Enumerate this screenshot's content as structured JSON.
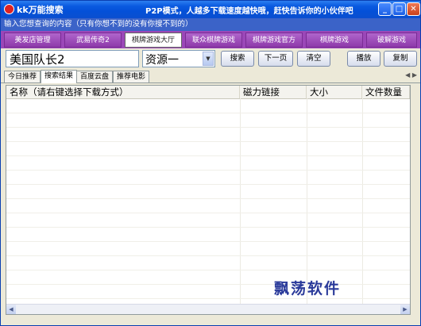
{
  "window": {
    "title": "kk万能搜索",
    "slogan": "P2P模式，人越多下载速度越快哦，赶快告诉你的小伙伴吧",
    "controls": {
      "minimize": "_",
      "maximize": "□",
      "close": "✕"
    }
  },
  "hint": "输入您想查询的内容（只有你想不到的没有你搜不到的）",
  "nav": [
    {
      "label": "美发店管理"
    },
    {
      "label": "武易传奇2"
    },
    {
      "label": "棋牌游戏大厅"
    },
    {
      "label": "联众棋牌游戏"
    },
    {
      "label": "棋牌游戏官方"
    },
    {
      "label": "棋牌游戏"
    },
    {
      "label": "破解游戏"
    }
  ],
  "search": {
    "value": "美国队长2",
    "source": "资源一"
  },
  "buttons": {
    "search": "搜索",
    "next_page": "下一页",
    "clear": "清空",
    "play": "播放",
    "copy": "复制"
  },
  "tabs": [
    {
      "label": "今日推荐"
    },
    {
      "label": "搜索结果"
    },
    {
      "label": "百度云盘"
    },
    {
      "label": "推荐电影"
    }
  ],
  "table": {
    "columns": [
      "名称（请右键选择下载方式）",
      "磁力链接",
      "大小",
      "文件数量"
    ],
    "rows": []
  },
  "watermark": "飘荡软件",
  "icons": {
    "tab_prev": "◀",
    "tab_next": "▶",
    "scroll_left": "◀",
    "scroll_right": "▶",
    "select_arrow": "▼"
  }
}
